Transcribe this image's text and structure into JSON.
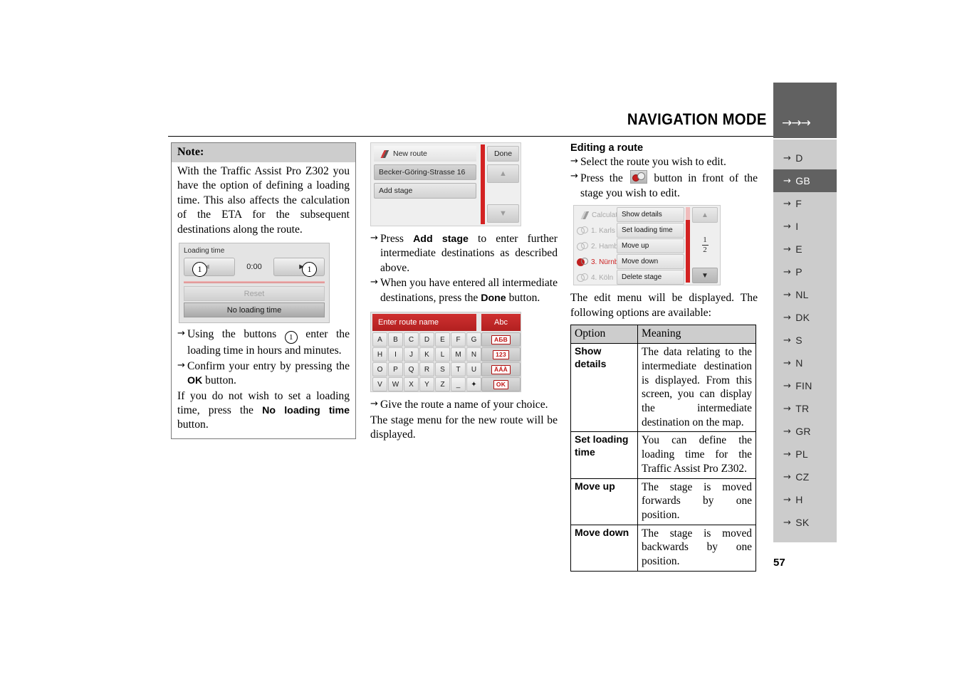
{
  "header": {
    "title": "NAVIGATION MODE",
    "arrows": "→→→"
  },
  "page_number": "57",
  "sidebar": {
    "items": [
      {
        "label": "D",
        "active": false
      },
      {
        "label": "GB",
        "active": true
      },
      {
        "label": "F",
        "active": false
      },
      {
        "label": "I",
        "active": false
      },
      {
        "label": "E",
        "active": false
      },
      {
        "label": "P",
        "active": false
      },
      {
        "label": "NL",
        "active": false
      },
      {
        "label": "DK",
        "active": false
      },
      {
        "label": "S",
        "active": false
      },
      {
        "label": "N",
        "active": false
      },
      {
        "label": "FIN",
        "active": false
      },
      {
        "label": "TR",
        "active": false
      },
      {
        "label": "GR",
        "active": false
      },
      {
        "label": "PL",
        "active": false
      },
      {
        "label": "CZ",
        "active": false
      },
      {
        "label": "H",
        "active": false
      },
      {
        "label": "SK",
        "active": false
      }
    ],
    "arrow_glyph": "→"
  },
  "column1": {
    "note": {
      "heading": "Note:",
      "body": "With the Traffic Assist Pro Z302 you have the option of defining a loading time. This also affects the calculation of the ETA for the subsequent destinations along the route."
    },
    "loading_screen": {
      "title": "Loading time",
      "value": "0:00",
      "left_arrow": "◄",
      "right_arrow": "►",
      "callout_left": "1",
      "callout_right": "1",
      "reset_label": "Reset",
      "no_loading_label": "No loading time"
    },
    "steps": [
      {
        "text_a": "Using the buttons ",
        "callout": "1",
        "text_b": " enter the loading time in hours and minutes."
      },
      {
        "text_a": "Confirm your entry by pressing the ",
        "bold": "OK",
        "text_b": " button."
      }
    ],
    "closing_a": "If you do not wish to set a loading time, press the ",
    "closing_bold": "No loading time",
    "closing_b": " button."
  },
  "column2": {
    "new_route_screen": {
      "title": "New route",
      "done_label": "Done",
      "items": [
        "Becker-Göring-Strasse 16",
        "Add stage"
      ],
      "scroll_up": "▲",
      "scroll_down": "▼"
    },
    "steps": [
      {
        "a": "Press ",
        "bold": "Add stage",
        "b": " to enter further intermediate destinations as described above."
      },
      {
        "a": "When you have entered all intermediate destinations, press the ",
        "bold": "Done",
        "b": " button."
      }
    ],
    "keyboard_screen": {
      "entry_placeholder": "Enter route name",
      "mode_label": "Abc",
      "keys": [
        [
          "A",
          "B",
          "C",
          "D",
          "E",
          "F",
          "G"
        ],
        [
          "H",
          "I",
          "J",
          "K",
          "L",
          "M",
          "N"
        ],
        [
          "O",
          "P",
          "Q",
          "R",
          "S",
          "T",
          "U"
        ],
        [
          "V",
          "W",
          "X",
          "Y",
          "Z",
          "_",
          "✦"
        ]
      ],
      "special_keys": [
        "АБВ",
        "123",
        "ÄÁÀ",
        "OK"
      ]
    },
    "closing_step": "Give the route a name of your choice.",
    "closing_text": "The stage menu for the new route will be displayed."
  },
  "column3": {
    "heading": "Editing a route",
    "steps": [
      {
        "a": "Select the route you wish to edit.",
        "bold": "",
        "b": ""
      },
      {
        "a": "Press the ",
        "icon": "stage-button-icon",
        "b": " button in front of the stage you wish to edit."
      }
    ],
    "edit_menu_screen": {
      "background_rows": [
        {
          "label": "Calculat",
          "icon": "flag-icon",
          "selected": false
        },
        {
          "label": "1. Karls",
          "icon": "stage-icon",
          "selected": false
        },
        {
          "label": "2. Hamb",
          "icon": "stage-icon",
          "selected": false
        },
        {
          "label": "3. Nürnb",
          "icon": "stage-icon-red",
          "selected": true
        },
        {
          "label": "4. Köln",
          "icon": "stage-icon",
          "selected": false
        }
      ],
      "menu_items": [
        "Show details",
        "Set loading time",
        "Move up",
        "Move down",
        "Delete stage"
      ],
      "page_indicator_top": "1",
      "page_indicator_bottom": "2",
      "scroll_up": "▲",
      "scroll_down": "▼"
    },
    "intro": "The edit menu will be displayed. The following options are available:",
    "table": {
      "headers": [
        "Option",
        "Meaning"
      ],
      "rows": [
        {
          "option": "Show details",
          "meaning": "The data relating to the intermediate destination is displayed. From this screen, you can display the intermediate destination on the map."
        },
        {
          "option": "Set loading time",
          "meaning": "You can define the loading time for the Traffic Assist Pro Z302."
        },
        {
          "option": "Move up",
          "meaning": "The stage is moved forwards by one position."
        },
        {
          "option": "Move down",
          "meaning": "The stage is moved backwards by one position."
        }
      ]
    }
  },
  "colors": {
    "accent_red": "#d32222",
    "header_tab": "#616161",
    "sidebar_bg": "#cccccc",
    "table_header": "#cdcdcd"
  }
}
